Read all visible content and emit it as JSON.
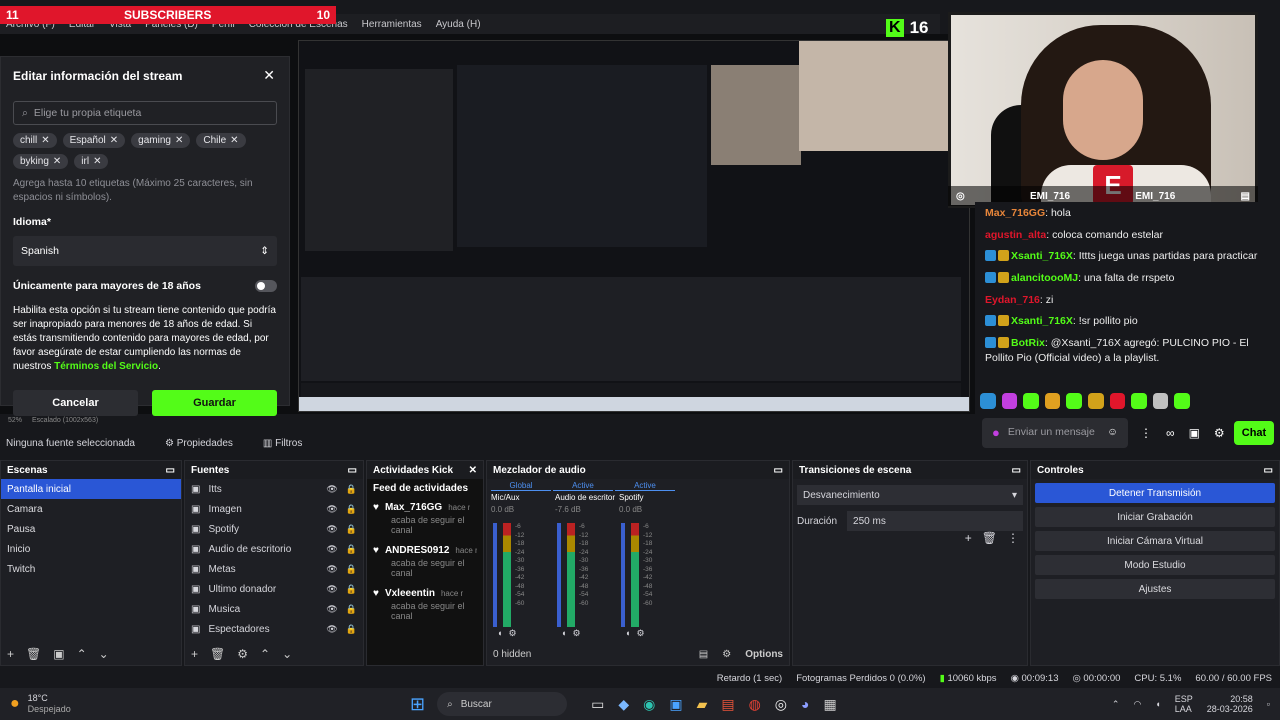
{
  "overlay": {
    "subs_left": "11",
    "subs_label": "SUBSCRIBERS",
    "subs_right": "10",
    "kick_count": "16"
  },
  "menubar": {
    "items": [
      "Archivo (F)",
      "Editar",
      "Vista",
      "Paneles (D)",
      "Perfil",
      "Colección de Escenas",
      "Herramientas",
      "Ayuda (H)"
    ]
  },
  "dialog": {
    "title": "Editar información del stream",
    "tag_placeholder": "Elige tu propia etiqueta",
    "tags": [
      "chill",
      "Español",
      "gaming",
      "Chile",
      "byking",
      "irl"
    ],
    "tag_hint": "Agrega hasta 10 etiquetas (Máximo 25 caracteres, sin espacios ni símbolos).",
    "language_label": "Idioma*",
    "language_value": "Spanish",
    "adult_label": "Únicamente para mayores de 18 años",
    "adult_text": "Habilita esta opción si tu stream tiene contenido que podría ser inapropiado para menores de 18 años de edad. Si estás transmitiendo contenido para mayores de edad, por favor asegúrate de estar cumpliendo las normas de nuestros",
    "terms_link": "Términos del Servicio",
    "cancel": "Cancelar",
    "save": "Guardar"
  },
  "webcam": {
    "name_left": "EMI_716",
    "name_right": "EMI_716"
  },
  "chat": {
    "messages": [
      {
        "user": "Max_716GG",
        "text": "hola",
        "color": "#e8863a"
      },
      {
        "user": "agustin_alta",
        "text": "coloca comando estelar",
        "color": "#e0162b"
      },
      {
        "user": "Xsanti_716X",
        "text": "Ittts juega unas partidas para practicar",
        "color": "#53fc18"
      },
      {
        "user": "alancitoooMJ",
        "text": "una falta de rrspeto",
        "color": "#53fc18"
      },
      {
        "user": "Eydan_716",
        "text": "zi",
        "color": "#e0162b"
      },
      {
        "user": "Xsanti_716X",
        "text": "!sr pollito pio",
        "color": "#53fc18"
      },
      {
        "user": "BotRix",
        "text": "@Xsanti_716X agregó: PULCINO PIO - El Pollito Pio (Official video) a la playlist.",
        "color": "#53fc18"
      }
    ],
    "input_placeholder": "Enviar un mensaje",
    "send": "Chat"
  },
  "preview_zoom": "52%",
  "preview_scale": "Escalado (1002x563)",
  "sourcebar": {
    "none": "Ninguna fuente seleccionada",
    "props": "Propiedades",
    "filters": "Filtros"
  },
  "scenes": {
    "title": "Escenas",
    "items": [
      "Pantalla inicial",
      "Camara",
      "Pausa",
      "Inicio",
      "Twitch"
    ]
  },
  "sources": {
    "title": "Fuentes",
    "items": [
      "Itts",
      "Imagen",
      "Spotify",
      "Audio de escritorio",
      "Metas",
      "Ultimo donador",
      "Musica",
      "Espectadores"
    ]
  },
  "activity": {
    "title": "Actividades Kick",
    "feed": "Feed de actividades",
    "items": [
      {
        "user": "Max_716GG",
        "time": "hace minut",
        "action": "acaba de seguir el canal"
      },
      {
        "user": "ANDRES0912",
        "time": "hace minut",
        "action": "acaba de seguir el canal"
      },
      {
        "user": "Vxleeentin",
        "time": "hace minut",
        "action": "acaba de seguir el canal"
      }
    ]
  },
  "mixer": {
    "title": "Mezclador de audio",
    "tabs": [
      "Global",
      "Active",
      "Active"
    ],
    "channels": [
      {
        "name": "Mic/Aux",
        "db": "0.0 dB"
      },
      {
        "name": "Audio de escritor",
        "db": "-7.6 dB"
      },
      {
        "name": "Spotify",
        "db": "0.0 dB"
      }
    ],
    "scale": [
      "-6",
      "-12",
      "-18",
      "-24",
      "-30",
      "-36",
      "-42",
      "-48",
      "-54",
      "-60"
    ],
    "hidden": "0 hidden",
    "options": "Options"
  },
  "transitions": {
    "title": "Transiciones de escena",
    "value": "Desvanecimiento",
    "duration_label": "Duración",
    "duration": "250 ms"
  },
  "controls": {
    "title": "Controles",
    "buttons": [
      "Detener Transmisión",
      "Iniciar Grabación",
      "Iniciar Cámara Virtual",
      "Modo Estudio",
      "Ajustes"
    ]
  },
  "status": {
    "delay": "Retardo (1 sec)",
    "dropped": "Fotogramas Perdidos 0 (0.0%)",
    "bitrate": "10060 kbps",
    "live": "00:09:13",
    "rec": "00:00:00",
    "cpu": "CPU: 5.1%",
    "fps": "60.00 / 60.00 FPS"
  },
  "taskbar": {
    "temp": "18°C",
    "weather": "Despejado",
    "search": "Buscar",
    "lang1": "ESP",
    "lang2": "LAA",
    "time": "20:58",
    "date": "28-03-2026"
  }
}
